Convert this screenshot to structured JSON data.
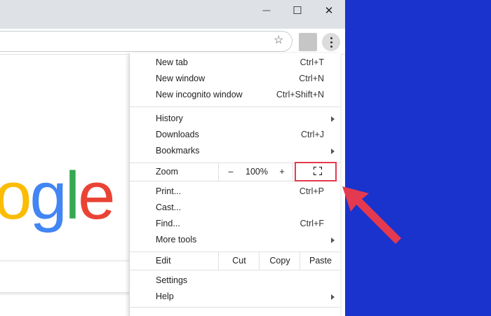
{
  "window_controls": {
    "minimize": "—",
    "maximize": "☐",
    "close": "✕"
  },
  "toolbar": {
    "bookmark_icon": "☆"
  },
  "logo": {
    "letters": [
      {
        "ch": "o",
        "color": "#fbbc05"
      },
      {
        "ch": "g",
        "color": "#4285f4"
      },
      {
        "ch": "l",
        "color": "#34a853"
      },
      {
        "ch": "e",
        "color": "#ea4335"
      }
    ]
  },
  "menu": {
    "new_tab": {
      "label": "New tab",
      "shortcut": "Ctrl+T"
    },
    "new_window": {
      "label": "New window",
      "shortcut": "Ctrl+N"
    },
    "new_incognito": {
      "label": "New incognito window",
      "shortcut": "Ctrl+Shift+N"
    },
    "history": {
      "label": "History"
    },
    "downloads": {
      "label": "Downloads",
      "shortcut": "Ctrl+J"
    },
    "bookmarks": {
      "label": "Bookmarks"
    },
    "zoom": {
      "label": "Zoom",
      "minus": "–",
      "level": "100%",
      "plus": "+"
    },
    "print": {
      "label": "Print...",
      "shortcut": "Ctrl+P"
    },
    "cast": {
      "label": "Cast..."
    },
    "find": {
      "label": "Find...",
      "shortcut": "Ctrl+F"
    },
    "more_tools": {
      "label": "More tools"
    },
    "edit": {
      "label": "Edit",
      "cut": "Cut",
      "copy": "Copy",
      "paste": "Paste"
    },
    "settings": {
      "label": "Settings"
    },
    "help": {
      "label": "Help"
    }
  },
  "colors": {
    "annotation": "#e53950",
    "background_panel": "#1a33cc"
  }
}
